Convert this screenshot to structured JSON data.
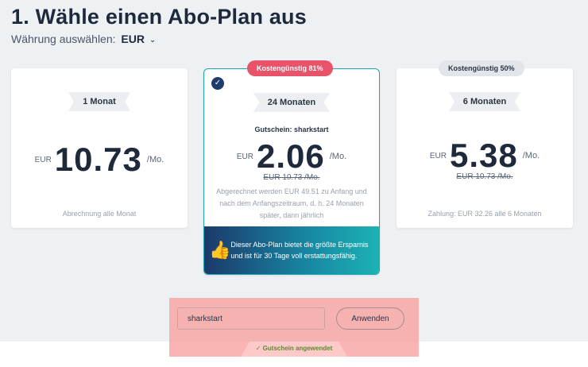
{
  "page": {
    "title": "1. Wähle einen Abo-Plan aus",
    "currency_label": "Währung auswählen:",
    "currency_value": "EUR"
  },
  "plans": [
    {
      "name": "1 Monat",
      "currency": "EUR",
      "price": "10.73",
      "per": "/Mo.",
      "billing": "Abrechnung alle Monat"
    },
    {
      "badge": "Kostengünstig 81%",
      "name": "24 Monaten",
      "coupon": "Gutschein: sharkstart",
      "currency": "EUR",
      "price": "2.06",
      "per": "/Mo.",
      "old_price": "EUR 10.73 /Mo.",
      "billing": "Abgerechnet werden EUR 49.51 zu Anfang und nach dem Anfangszeitraum, d. h. 24 Monaten später, dann jährlich",
      "promo": "Dieser Abo-Plan bietet die größte Ersparnis und ist für 30 Tage voll erstattungsfähig.",
      "selected": true
    },
    {
      "badge": "Kostengünstig 50%",
      "name": "6 Monaten",
      "currency": "EUR",
      "price": "5.38",
      "per": "/Mo.",
      "old_price": "EUR 10.73 /Mo.",
      "billing": "Zahlung: EUR 32.26 alle 6 Monaten"
    }
  ],
  "coupon_form": {
    "input_value": "sharkstart",
    "apply_label": "Anwenden",
    "status": "Gutschein angewendet"
  },
  "colors": {
    "accent_teal": "#1ea5b8",
    "badge_red": "#e8536a",
    "success_green": "#5b8a2e"
  }
}
